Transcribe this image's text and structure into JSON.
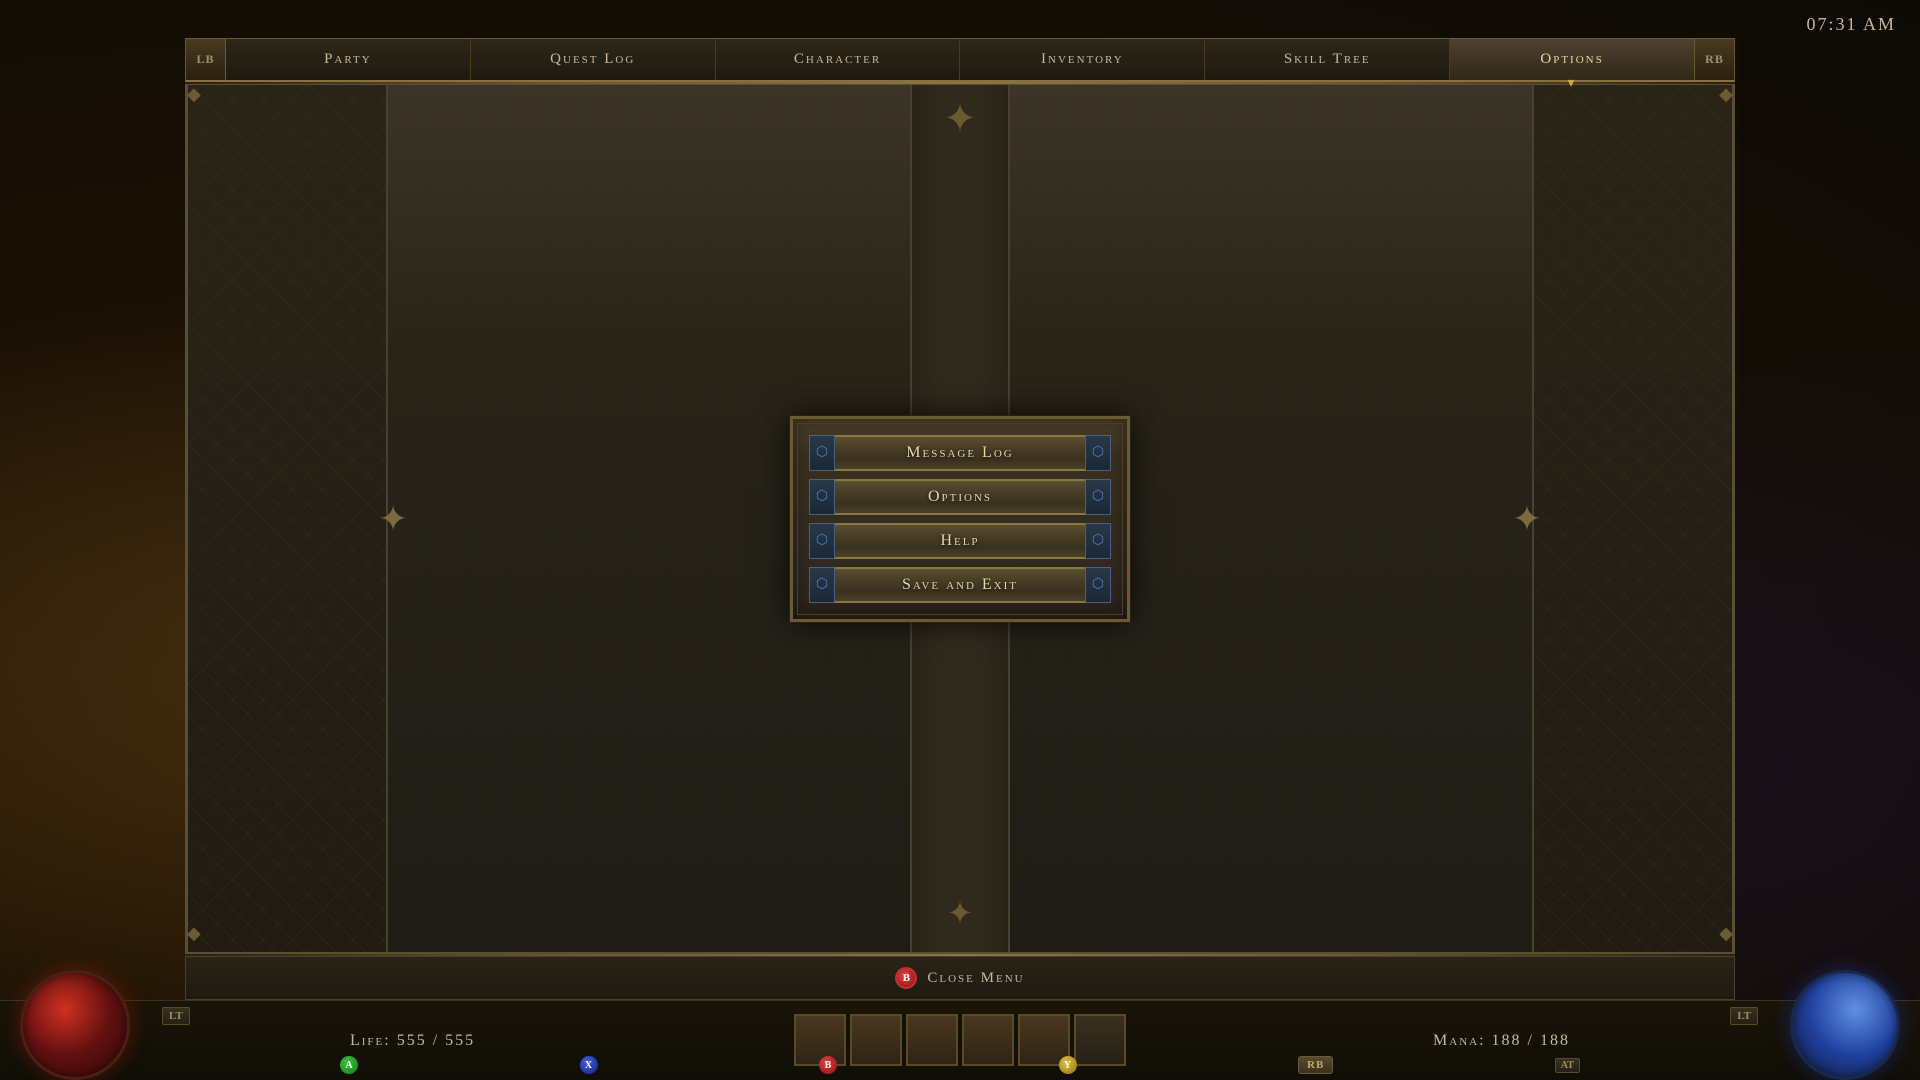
{
  "clock": "07:31 AM",
  "nav": {
    "lb_label": "LB",
    "rb_label": "RB",
    "tabs": [
      {
        "id": "party",
        "label": "Party",
        "active": false
      },
      {
        "id": "questlog",
        "label": "Quest Log",
        "active": false
      },
      {
        "id": "character",
        "label": "Character",
        "active": false
      },
      {
        "id": "inventory",
        "label": "Inventory",
        "active": false
      },
      {
        "id": "skilltree",
        "label": "Skill Tree",
        "active": false
      },
      {
        "id": "options",
        "label": "Options",
        "active": true
      }
    ]
  },
  "menu_buttons": [
    {
      "id": "message-log",
      "label": "Message Log"
    },
    {
      "id": "options",
      "label": "Options"
    },
    {
      "id": "help",
      "label": "Help"
    },
    {
      "id": "save-exit",
      "label": "Save and Exit"
    }
  ],
  "bottom_bar": {
    "b_button": "B",
    "close_label": "Close Menu"
  },
  "hud": {
    "life_label": "Life: 555 / 555",
    "mana_label": "Mana: 188 / 188"
  },
  "controller": {
    "a": "A",
    "b": "B",
    "x": "X",
    "y": "Y",
    "rb": "RB",
    "at": "AT",
    "lt": "LT",
    "rt": "LT"
  }
}
